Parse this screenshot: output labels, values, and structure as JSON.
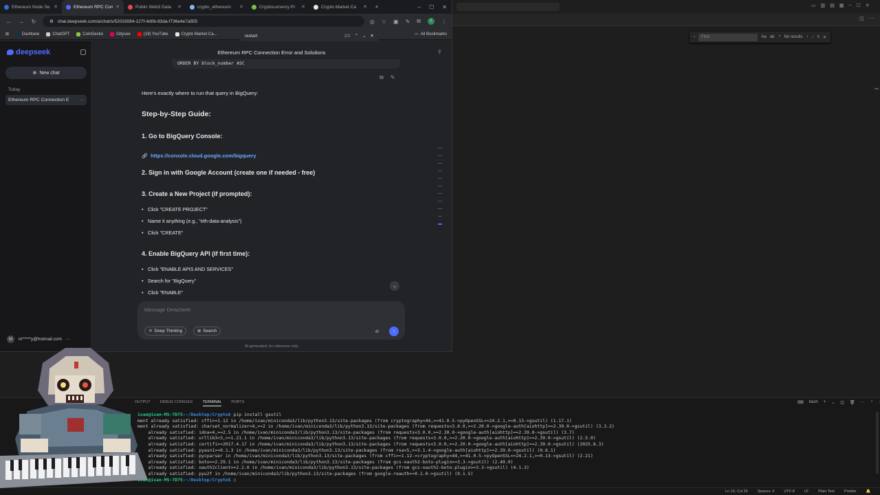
{
  "browser": {
    "tabs": [
      {
        "title": "Ethereum Node Se",
        "active": false,
        "color": "#3b6ad6"
      },
      {
        "title": "Ethereum RPC Con",
        "active": true,
        "color": "#4d6bfe"
      },
      {
        "title": "Public Web3 Data",
        "active": false,
        "color": "#e5484d"
      },
      {
        "title": "crypto_ethereum",
        "active": false,
        "color": "#8ab4f8"
      },
      {
        "title": "Cryptocurrency Pr",
        "active": false,
        "color": "#7ac143"
      },
      {
        "title": "Crypto Market Ca",
        "active": false,
        "color": "#e6e6e6"
      }
    ],
    "url": "chat.deepseek.com/a/chat/s/52033084-127f-4d0b-83da-f736e4e7a555",
    "bookmarks": [
      {
        "label": "Dashlane",
        "color": "#0e353d"
      },
      {
        "label": "ChatGPT",
        "color": "#cfcfcf"
      },
      {
        "label": "CoinGecko",
        "color": "#8dc63f"
      },
      {
        "label": "Odysee",
        "color": "#e50054"
      },
      {
        "label": "(19) YouTube",
        "color": "#ff0000"
      },
      {
        "label": "Crypto Market Ca...",
        "color": "#e6e6e6"
      }
    ],
    "all_bookmarks": "All Bookmarks",
    "find": {
      "query": "restart",
      "count": "2/2"
    }
  },
  "sidebar": {
    "logo": "deepseek",
    "new_chat": "New chat",
    "section": "Today",
    "history_item": "Ethereum RPC Connection E",
    "user_initial": "M",
    "user_email": "m*****y@hotmail.com"
  },
  "chat": {
    "title": "Ethereum RPC Connection Error and Solutions",
    "code_tail": "ORDER BY block_number ASC",
    "intro": "Here's exactly where to run that query in BigQuery:",
    "guide_heading": "Step-by-Step Guide:",
    "step1": "1. Go to BigQuery Console:",
    "step1_link": "https://console.cloud.google.com/bigquery",
    "step2": "2. Sign in with Google Account (create one if needed - free)",
    "step3": "3. Create a New Project (if prompted):",
    "step3_items": [
      "Click \"CREATE PROJECT\"",
      "Name it anything (e.g., \"eth-data-analysis\")",
      "Click \"CREATE\""
    ],
    "step4": "4. Enable BigQuery API (if first time):",
    "step4_items": [
      "Click \"ENABLE APIS AND SERVICES\"",
      "Search for \"BigQuery\"",
      "Click \"ENABLE\""
    ],
    "input_placeholder": "Message DeepSeek",
    "deep_thinking": "Deep Thinking",
    "search": "Search",
    "disclaimer": "AI-generated, for reference only"
  },
  "editor": {
    "find_placeholder": "Find",
    "find_result": "No results"
  },
  "panel": {
    "tabs": [
      "OUTPUT",
      "DEBUG CONSOLE",
      "TERMINAL",
      "PORTS"
    ],
    "active_tab": "TERMINAL",
    "shell": "bash",
    "prompt_user": "ivan@ivan-MS-7D75",
    "prompt_path": ":~/Desktop/Crypto$",
    "command": " pip install gsutil",
    "output": [
      "ment already satisfied: cffi>=1.12 in /home/ivan/miniconda3/lib/python3.13/site-packages (from cryptography<44,>=41.0.5->pyOpenSSL<=24.2.1,>=0.13->gsutil) (1.17.1)",
      "ment already satisfied: charset_normalizer<4,>=2 in /home/ivan/miniconda3/lib/python3.13/site-packages (from requests<3.0.0,>=2.20.0->google-auth[aiohttp]==2.39.0->gsutil) (3.3.2)",
      "    already satisfied: idna<4,>=2.5 in /home/ivan/miniconda3/lib/python3.13/site-packages (from requests<3.0.0,>=2.20.0->google-auth[aiohttp]==2.39.0->gsutil) (3.7)",
      "    already satisfied: urllib3<3,>=1.21.1 in /home/ivan/miniconda3/lib/python3.13/site-packages (from requests<3.0.0,>=2.20.0->google-auth[aiohttp]==2.39.0->gsutil) (2.5.0)",
      "    already satisfied: certifi>=2017.4.17 in /home/ivan/miniconda3/lib/python3.13/site-packages (from requests<3.0.0,>=2.20.0->google-auth[aiohttp]==2.39.0->gsutil) (2025.8.3)",
      "    already satisfied: pyasn1>=0.1.3 in /home/ivan/miniconda3/lib/python3.13/site-packages (from rsa<5,>=3.1.4->google-auth[aiohttp]==2.39.0->gsutil) (0.6.1)",
      "    already satisfied: pycparser in /home/ivan/miniconda3/lib/python3.13/site-packages (from cffi>=1.12->cryptography<44,>=41.0.5->pyOpenSSL<=24.2.1,>=0.13->gsutil) (2.21)",
      "    already satisfied: boto==2.29.1 in /home/ivan/miniconda3/lib/python3.13/site-packages (from gcs-oauth2-boto-plugin>=3.3->gsutil) (2.49.0)",
      "    already satisfied: oauth2client>=2.2.0 in /home/ivan/miniconda3/lib/python3.13/site-packages (from gcs-oauth2-boto-plugin>=3.3->gsutil) (4.1.3)",
      "    already satisfied: pyu2f in /home/ivan/miniconda3/lib/python3.13/site-packages (from google-reauth>=0.1.0->gsutil) (0.1.5)"
    ]
  },
  "statusbar": {
    "position": "Ln 10, Col 26",
    "spaces": "Spaces: 4",
    "encoding": "UTF-8",
    "eol": "LF",
    "language": "Plain Text",
    "formatter": "Prettier"
  }
}
